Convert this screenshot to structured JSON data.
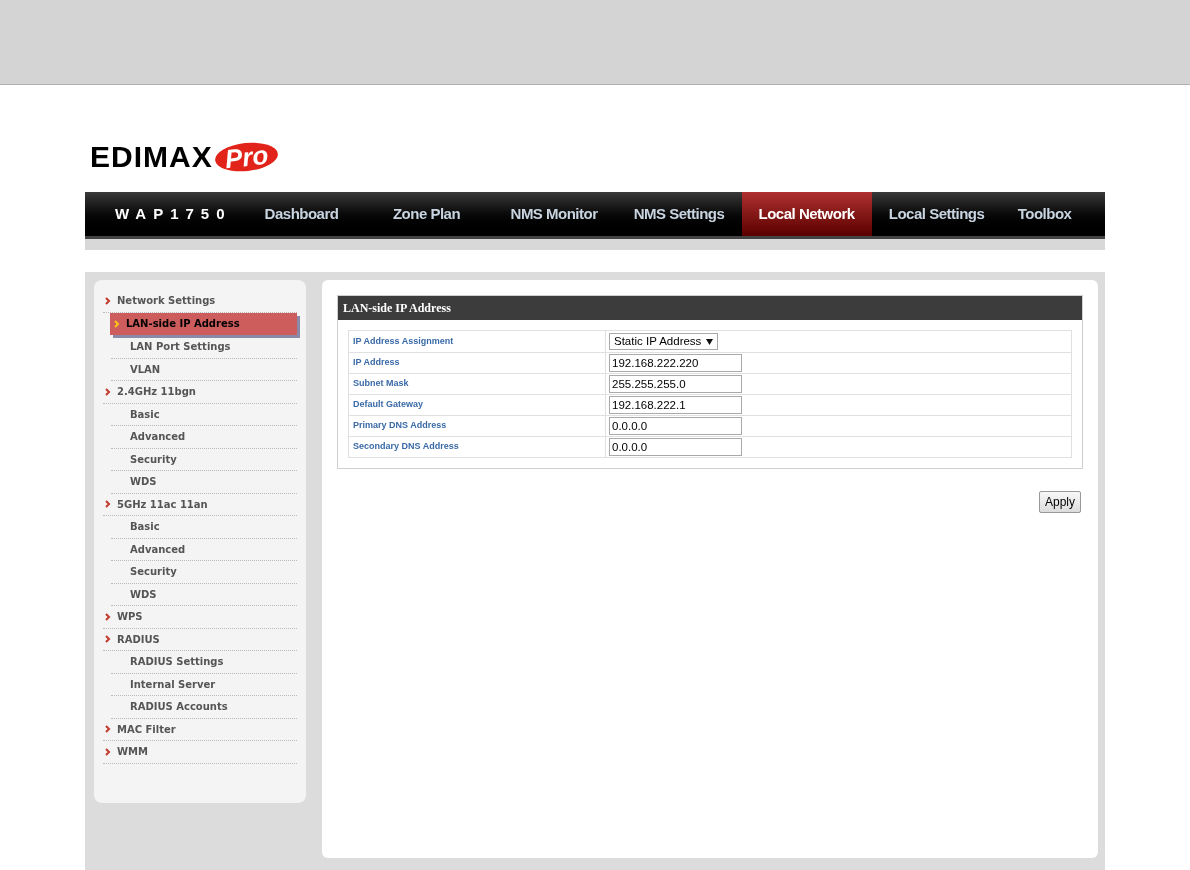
{
  "logo": {
    "brand": "EDIMAX",
    "badge": "Pro"
  },
  "nav": {
    "model": "WAP1750",
    "tabs": [
      {
        "label": "Dashboard",
        "selected": false
      },
      {
        "label": "Zone Plan",
        "selected": false
      },
      {
        "label": "NMS Monitor",
        "selected": false
      },
      {
        "label": "NMS Settings",
        "selected": false
      },
      {
        "label": "Local Network",
        "selected": true
      },
      {
        "label": "Local Settings",
        "selected": false
      },
      {
        "label": "Toolbox",
        "selected": false
      }
    ]
  },
  "sidebar": {
    "items": [
      {
        "label": "Network Settings",
        "selected": false,
        "children": [
          {
            "label": "LAN-side IP Address",
            "selected": true
          },
          {
            "label": "LAN Port Settings",
            "selected": false
          },
          {
            "label": "VLAN",
            "selected": false
          }
        ]
      },
      {
        "label": "2.4GHz 11bgn",
        "selected": false,
        "children": [
          {
            "label": "Basic",
            "selected": false
          },
          {
            "label": "Advanced",
            "selected": false
          },
          {
            "label": "Security",
            "selected": false
          },
          {
            "label": "WDS",
            "selected": false
          }
        ]
      },
      {
        "label": "5GHz 11ac 11an",
        "selected": false,
        "children": [
          {
            "label": "Basic",
            "selected": false
          },
          {
            "label": "Advanced",
            "selected": false
          },
          {
            "label": "Security",
            "selected": false
          },
          {
            "label": "WDS",
            "selected": false
          }
        ]
      },
      {
        "label": "WPS",
        "selected": false
      },
      {
        "label": "RADIUS",
        "selected": false,
        "children": [
          {
            "label": "RADIUS Settings",
            "selected": false
          },
          {
            "label": "Internal Server",
            "selected": false
          },
          {
            "label": "RADIUS Accounts",
            "selected": false
          }
        ]
      },
      {
        "label": "MAC Filter",
        "selected": false
      },
      {
        "label": "WMM",
        "selected": false
      }
    ]
  },
  "panel": {
    "title": "LAN-side IP Address",
    "rows": [
      {
        "kind": "select",
        "label": "IP Address Assignment",
        "value": "Static IP Address"
      },
      {
        "kind": "input",
        "label": "IP Address",
        "value": "192.168.222.220"
      },
      {
        "kind": "input",
        "label": "Subnet Mask",
        "value": "255.255.255.0"
      },
      {
        "kind": "input",
        "label": "Default Gateway",
        "value": "192.168.222.1"
      },
      {
        "kind": "input",
        "label": "Primary DNS Address",
        "value": "0.0.0.0"
      },
      {
        "kind": "input",
        "label": "Secondary DNS Address",
        "value": "0.0.0.0"
      }
    ],
    "button": "Apply"
  }
}
